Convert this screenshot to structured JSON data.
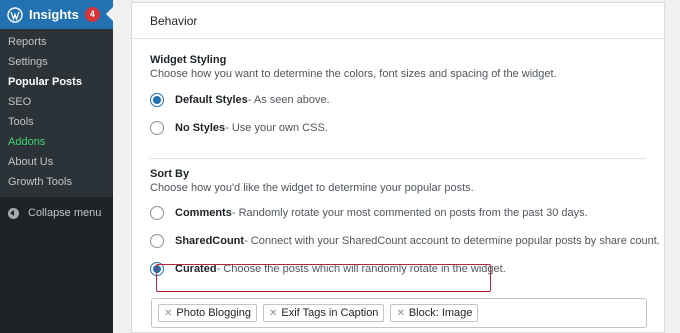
{
  "sidebar": {
    "title": "Insights",
    "badge": "4",
    "items": [
      {
        "label": "Reports"
      },
      {
        "label": "Settings"
      },
      {
        "label": "Popular Posts"
      },
      {
        "label": "SEO"
      },
      {
        "label": "Tools"
      },
      {
        "label": "Addons"
      },
      {
        "label": "About Us"
      },
      {
        "label": "Growth Tools"
      }
    ],
    "current_item": "Popular Posts",
    "collapse_label": "Collapse menu"
  },
  "panel": {
    "heading": "Behavior",
    "widget_styling": {
      "title": "Widget Styling",
      "description": "Choose how you want to determine the colors, font sizes and spacing of the widget.",
      "options": [
        {
          "label": "Default Styles",
          "detail": " - As seen above.",
          "selected": true
        },
        {
          "label": "No Styles",
          "detail": " - Use your own CSS.",
          "selected": false
        }
      ]
    },
    "sort_by": {
      "title": "Sort By",
      "description": "Choose how you'd like the widget to determine your popular posts.",
      "options": [
        {
          "label": "Comments",
          "detail": " - Randomly rotate your most commented on posts from the past 30 days.",
          "selected": false
        },
        {
          "label": "SharedCount",
          "detail": " - Connect with your SharedCount account to determine popular posts by share count.",
          "selected": false
        },
        {
          "label": "Curated",
          "detail": " - Choose the posts which will randomly rotate in the widget.",
          "selected": true
        }
      ]
    },
    "curated_tags": [
      "Photo Blogging",
      "Exif Tags in Caption",
      "Block: Image"
    ]
  },
  "colors": {
    "sidebar_bg": "#1d2327",
    "active_menu": "#2271b1",
    "badge": "#d63638",
    "addons_text": "#3ed56f",
    "radio_selected": "#2271b1",
    "highlight_border": "#b3263a"
  }
}
